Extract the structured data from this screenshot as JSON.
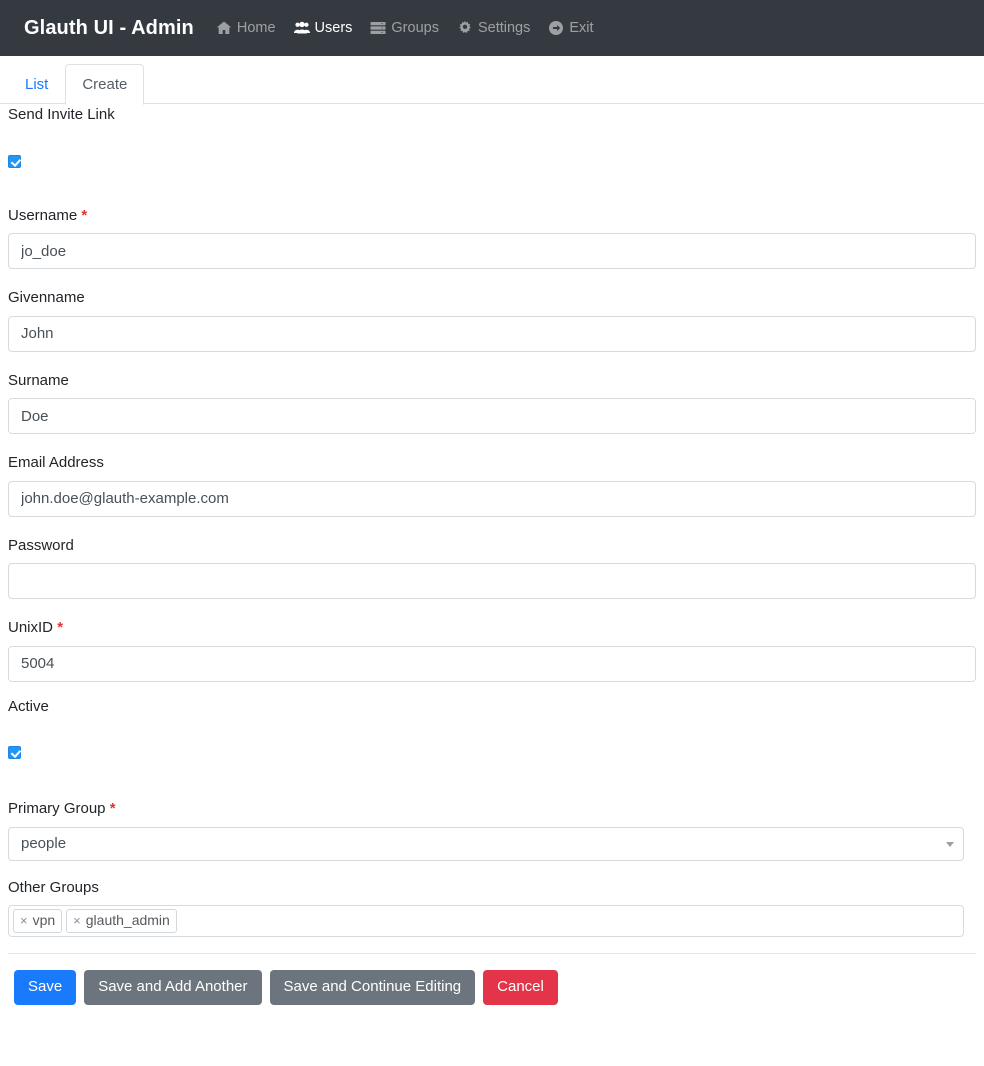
{
  "navbar": {
    "brand": "Glauth UI - Admin",
    "links": [
      {
        "label": "Home",
        "icon": "home-icon",
        "active": false
      },
      {
        "label": "Users",
        "icon": "users-icon",
        "active": true
      },
      {
        "label": "Groups",
        "icon": "groups-icon",
        "active": false
      },
      {
        "label": "Settings",
        "icon": "gear-icon",
        "active": false
      },
      {
        "label": "Exit",
        "icon": "exit-icon",
        "active": false
      }
    ],
    "background": "#343a40"
  },
  "tabs": [
    {
      "label": "List",
      "active": false
    },
    {
      "label": "Create",
      "active": true
    }
  ],
  "form": {
    "send_invite": {
      "label": "Send Invite Link",
      "checked": true
    },
    "username": {
      "label": "Username",
      "required": true,
      "required_mark": "*",
      "value": "jo_doe",
      "placeholder": ""
    },
    "givenname": {
      "label": "Givenname",
      "required": false,
      "value": "John",
      "placeholder": ""
    },
    "surname": {
      "label": "Surname",
      "required": false,
      "value": "Doe",
      "placeholder": ""
    },
    "email": {
      "label": "Email Address",
      "required": false,
      "value": "john.doe@glauth-example.com",
      "placeholder": ""
    },
    "password": {
      "label": "Password",
      "required": false,
      "value": "",
      "placeholder": ""
    },
    "unixid": {
      "label": "UnixID",
      "required": true,
      "required_mark": "*",
      "value": "5004",
      "placeholder": ""
    },
    "active": {
      "label": "Active",
      "checked": true
    },
    "primary_group": {
      "label": "Primary Group",
      "required": true,
      "required_mark": "*",
      "value": "people",
      "options": [
        "people"
      ]
    },
    "other_groups": {
      "label": "Other Groups",
      "tags": [
        {
          "remove": "×",
          "label": "vpn"
        },
        {
          "remove": "×",
          "label": "glauth_admin"
        }
      ]
    }
  },
  "actions": {
    "save": "Save",
    "save_add_another": "Save and Add Another",
    "save_continue": "Save and Continue Editing",
    "cancel": "Cancel"
  },
  "colors": {
    "navbar": "#343a40",
    "primary": "#1a7afc",
    "secondary": "#6c757d",
    "danger": "#e3344a",
    "required": "#e3342f",
    "checkbox": "#2196f3"
  }
}
